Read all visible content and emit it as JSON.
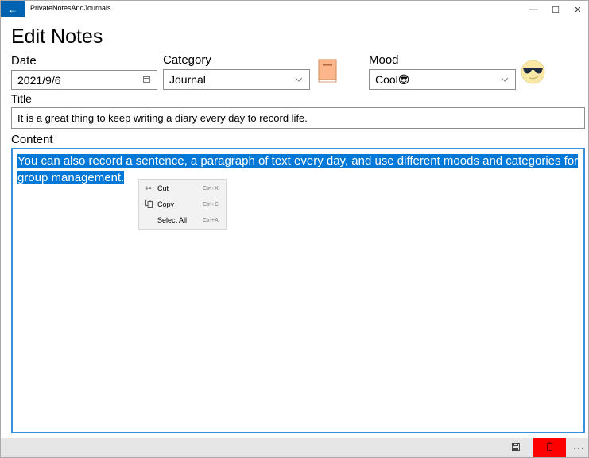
{
  "window": {
    "app_title": "PrivateNotesAndJournals",
    "back_icon": "arrow-left-icon",
    "controls": {
      "minimize": "—",
      "maximize": "☐",
      "close": "✕"
    }
  },
  "page": {
    "title": "Edit Notes"
  },
  "form": {
    "date": {
      "label": "Date",
      "value": "2021/9/6",
      "icon": "calendar-icon"
    },
    "category": {
      "label": "Category",
      "value": "Journal",
      "icon": "book-icon"
    },
    "mood": {
      "label": "Mood",
      "value": "Cool😎",
      "icon": "sunglasses-face-icon"
    },
    "title": {
      "label": "Title",
      "value": "It is a great thing to keep writing a diary every day to record life."
    },
    "content": {
      "label": "Content",
      "value": "You can also record a sentence, a paragraph of text every day, and use different moods and categories for group management."
    }
  },
  "context_menu": {
    "items": [
      {
        "label": "Cut",
        "shortcut": "Ctrl+X",
        "icon": "scissors-icon"
      },
      {
        "label": "Copy",
        "shortcut": "Ctrl+C",
        "icon": "copy-icon"
      },
      {
        "label": "Select All",
        "shortcut": "Ctrl+A",
        "icon": ""
      }
    ]
  },
  "command_bar": {
    "save_icon": "save-icon",
    "delete_icon": "delete-icon",
    "more_label": "···",
    "delete_color": "#ff0000"
  },
  "colors": {
    "accent": "#0078d7",
    "title_back": "#0063b1",
    "content_border": "#3a8fd9"
  }
}
